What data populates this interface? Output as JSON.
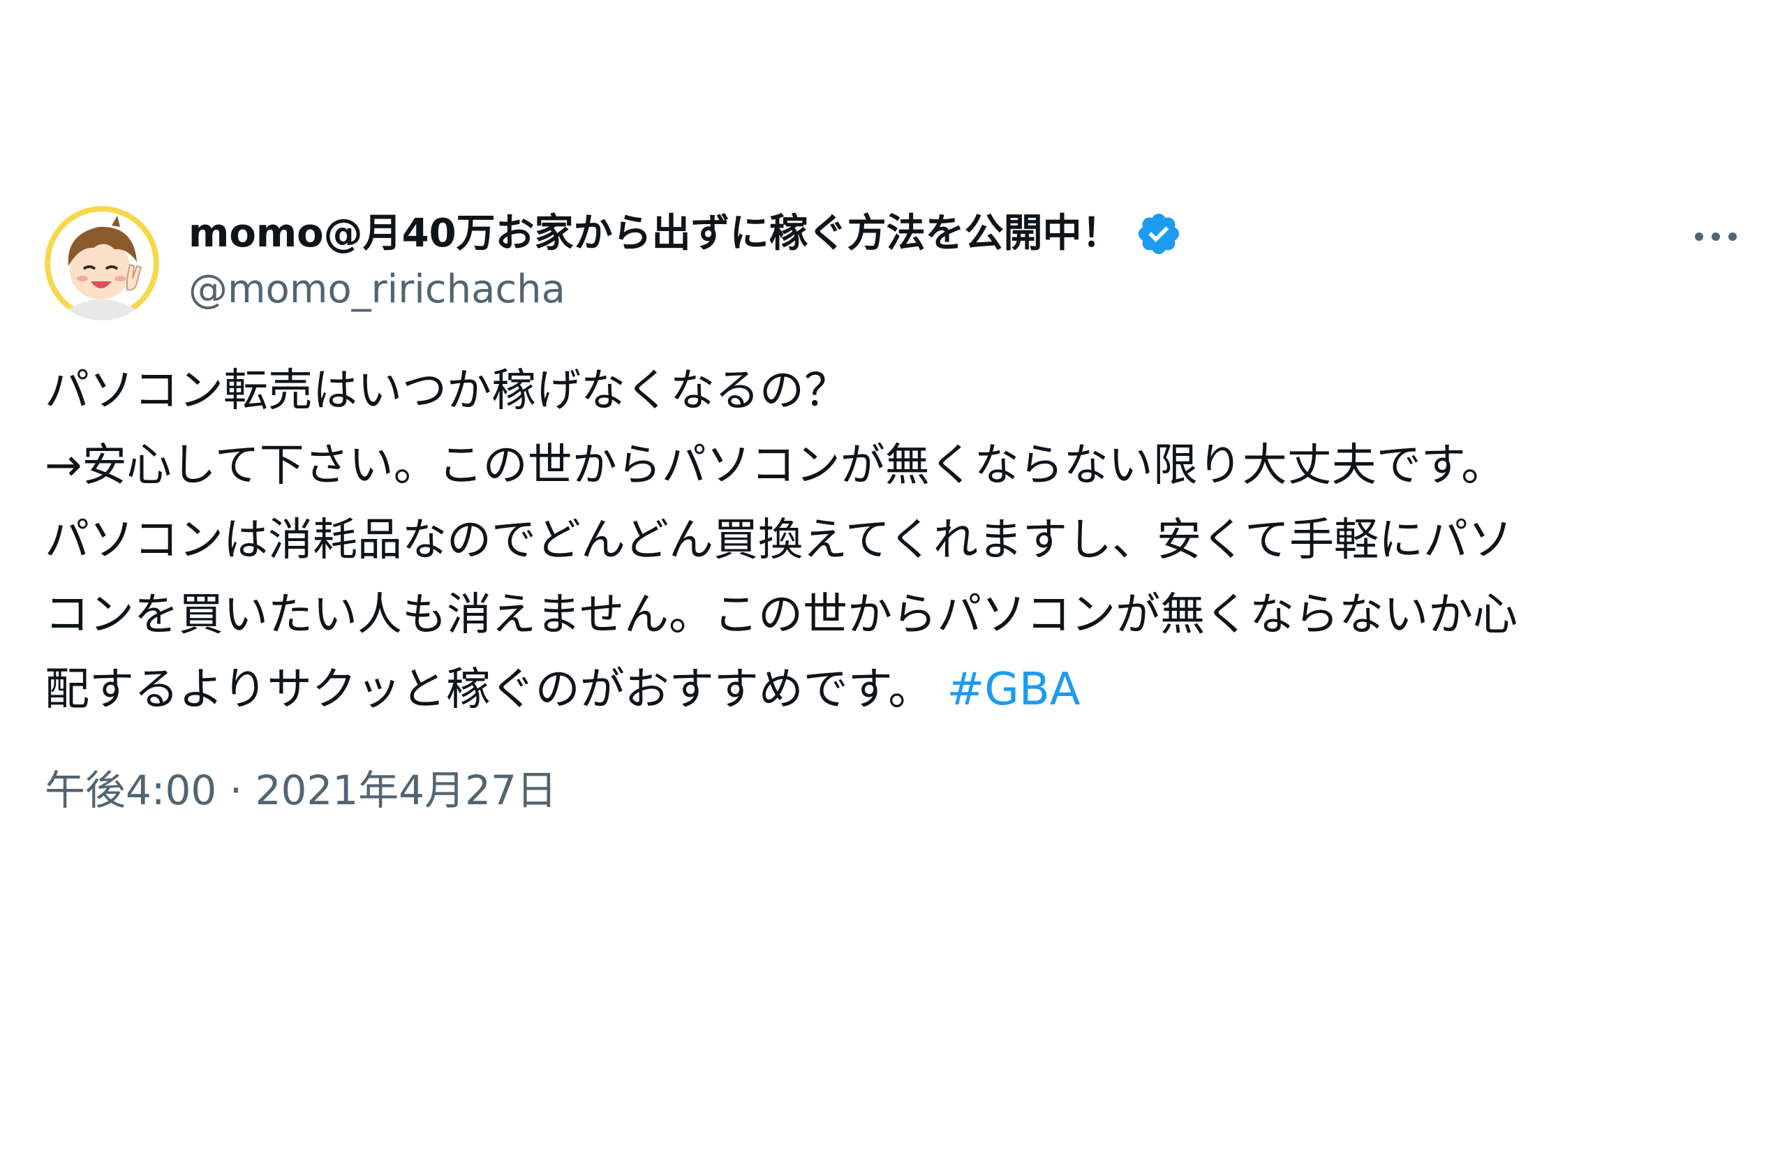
{
  "tweet": {
    "author": {
      "display_name": "momo@月40万お家から出ずに稼ぐ方法を公開中！",
      "handle": "@momo_ririchacha",
      "verified": true,
      "avatar_icon": "avatar-icon"
    },
    "more_icon": "more-icon",
    "body_lines": [
      "パソコン転売はいつか稼げなくなるの？",
      "→安心して下さい。この世からパソコンが無くならない限り大丈夫です。",
      "パソコンは消耗品なのでどんどん買換えてくれますし、安くて手軽にパソ",
      "コンを買いたい人も消えません。この世からパソコンが無くならないか心",
      "配するよりサクッと稼ぐのがおすすめです。"
    ],
    "hashtag": "#GBA",
    "time": "午後4:00",
    "separator": "·",
    "date": "2021年4月27日"
  },
  "colors": {
    "text": "#0f1419",
    "secondary": "#536471",
    "accent": "#1d9bf0"
  }
}
